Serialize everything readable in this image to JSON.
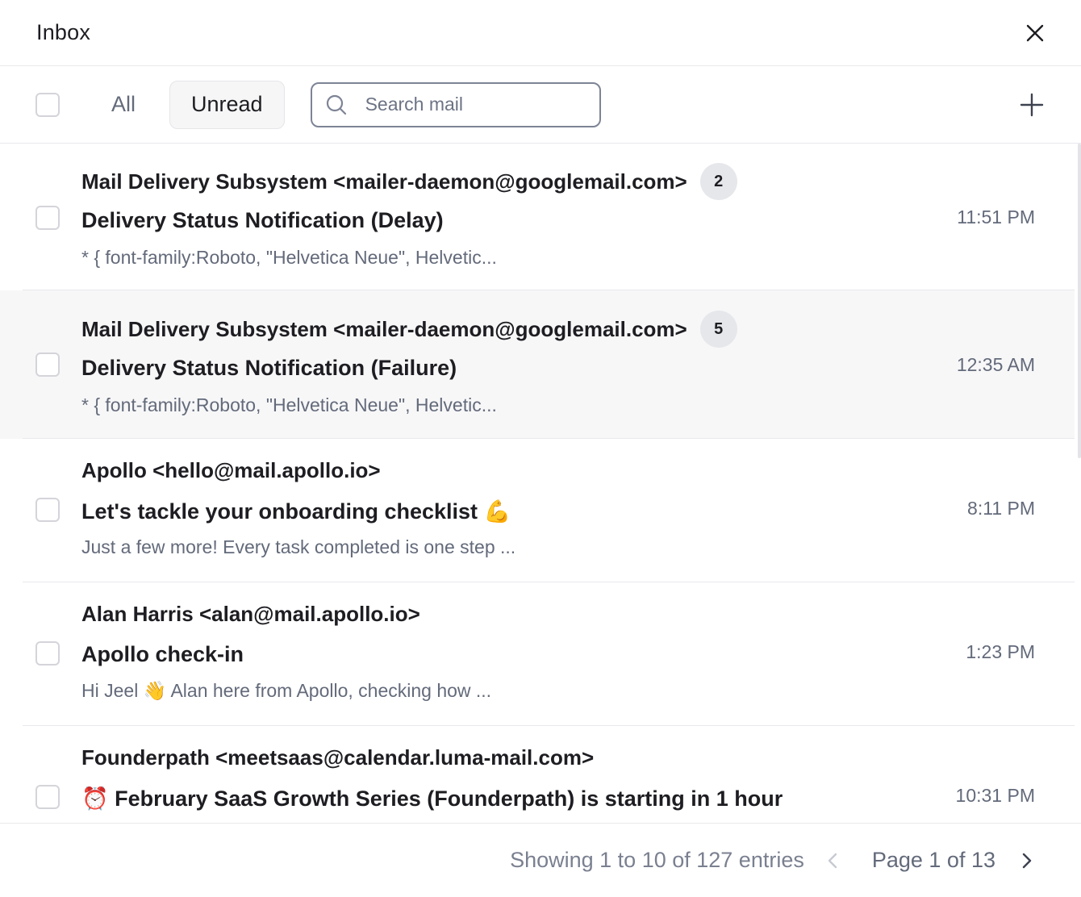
{
  "header": {
    "title": "Inbox"
  },
  "toolbar": {
    "filters": [
      {
        "label": "All",
        "active": false
      },
      {
        "label": "Unread",
        "active": true
      }
    ],
    "search": {
      "placeholder": "Search mail",
      "value": ""
    }
  },
  "emails": [
    {
      "sender": "Mail Delivery Subsystem <mailer-daemon@googlemail.com>",
      "count": "2",
      "subject": "Delivery Status Notification (Delay)",
      "preview": "* { font-family:Roboto, \"Helvetica Neue\", Helvetic...",
      "time": "11:51 PM",
      "highlighted": false
    },
    {
      "sender": "Mail Delivery Subsystem <mailer-daemon@googlemail.com>",
      "count": "5",
      "subject": "Delivery Status Notification (Failure)",
      "preview": "* { font-family:Roboto, \"Helvetica Neue\", Helvetic...",
      "time": "12:35 AM",
      "highlighted": true
    },
    {
      "sender": "Apollo <hello@mail.apollo.io>",
      "subject": "Let's tackle your onboarding checklist",
      "subject_emoji": "💪",
      "preview": "Just a few more! Every task completed is one step ...",
      "time": "8:11 PM",
      "highlighted": false
    },
    {
      "sender": "Alan Harris <alan@mail.apollo.io>",
      "subject": "Apollo check-in",
      "preview_before_emoji": "Hi Jeel",
      "preview_emoji": "👋",
      "preview_after_emoji": "Alan here from Apollo, checking how ...",
      "time": "1:23 PM",
      "highlighted": false
    },
    {
      "sender": "Founderpath <meetsaas@calendar.luma-mail.com>",
      "subject_emoji_prefix": "⏰",
      "subject": "February SaaS Growth Series (Founderpath) is starting in 1 hour",
      "time": "10:31 PM",
      "highlighted": false
    }
  ],
  "footer": {
    "entries": "Showing 1 to 10 of 127 entries",
    "page": "Page 1 of 13"
  },
  "colors": {
    "text_primary": "#1d1d22",
    "text_secondary": "#636a7a",
    "border": "#e9e9ee",
    "highlight_row": "#f7f7f8",
    "badge_bg": "#e6e7eb"
  },
  "icons": [
    "close-icon",
    "search-icon",
    "plus-icon",
    "chevron-left-icon",
    "chevron-right-icon"
  ]
}
